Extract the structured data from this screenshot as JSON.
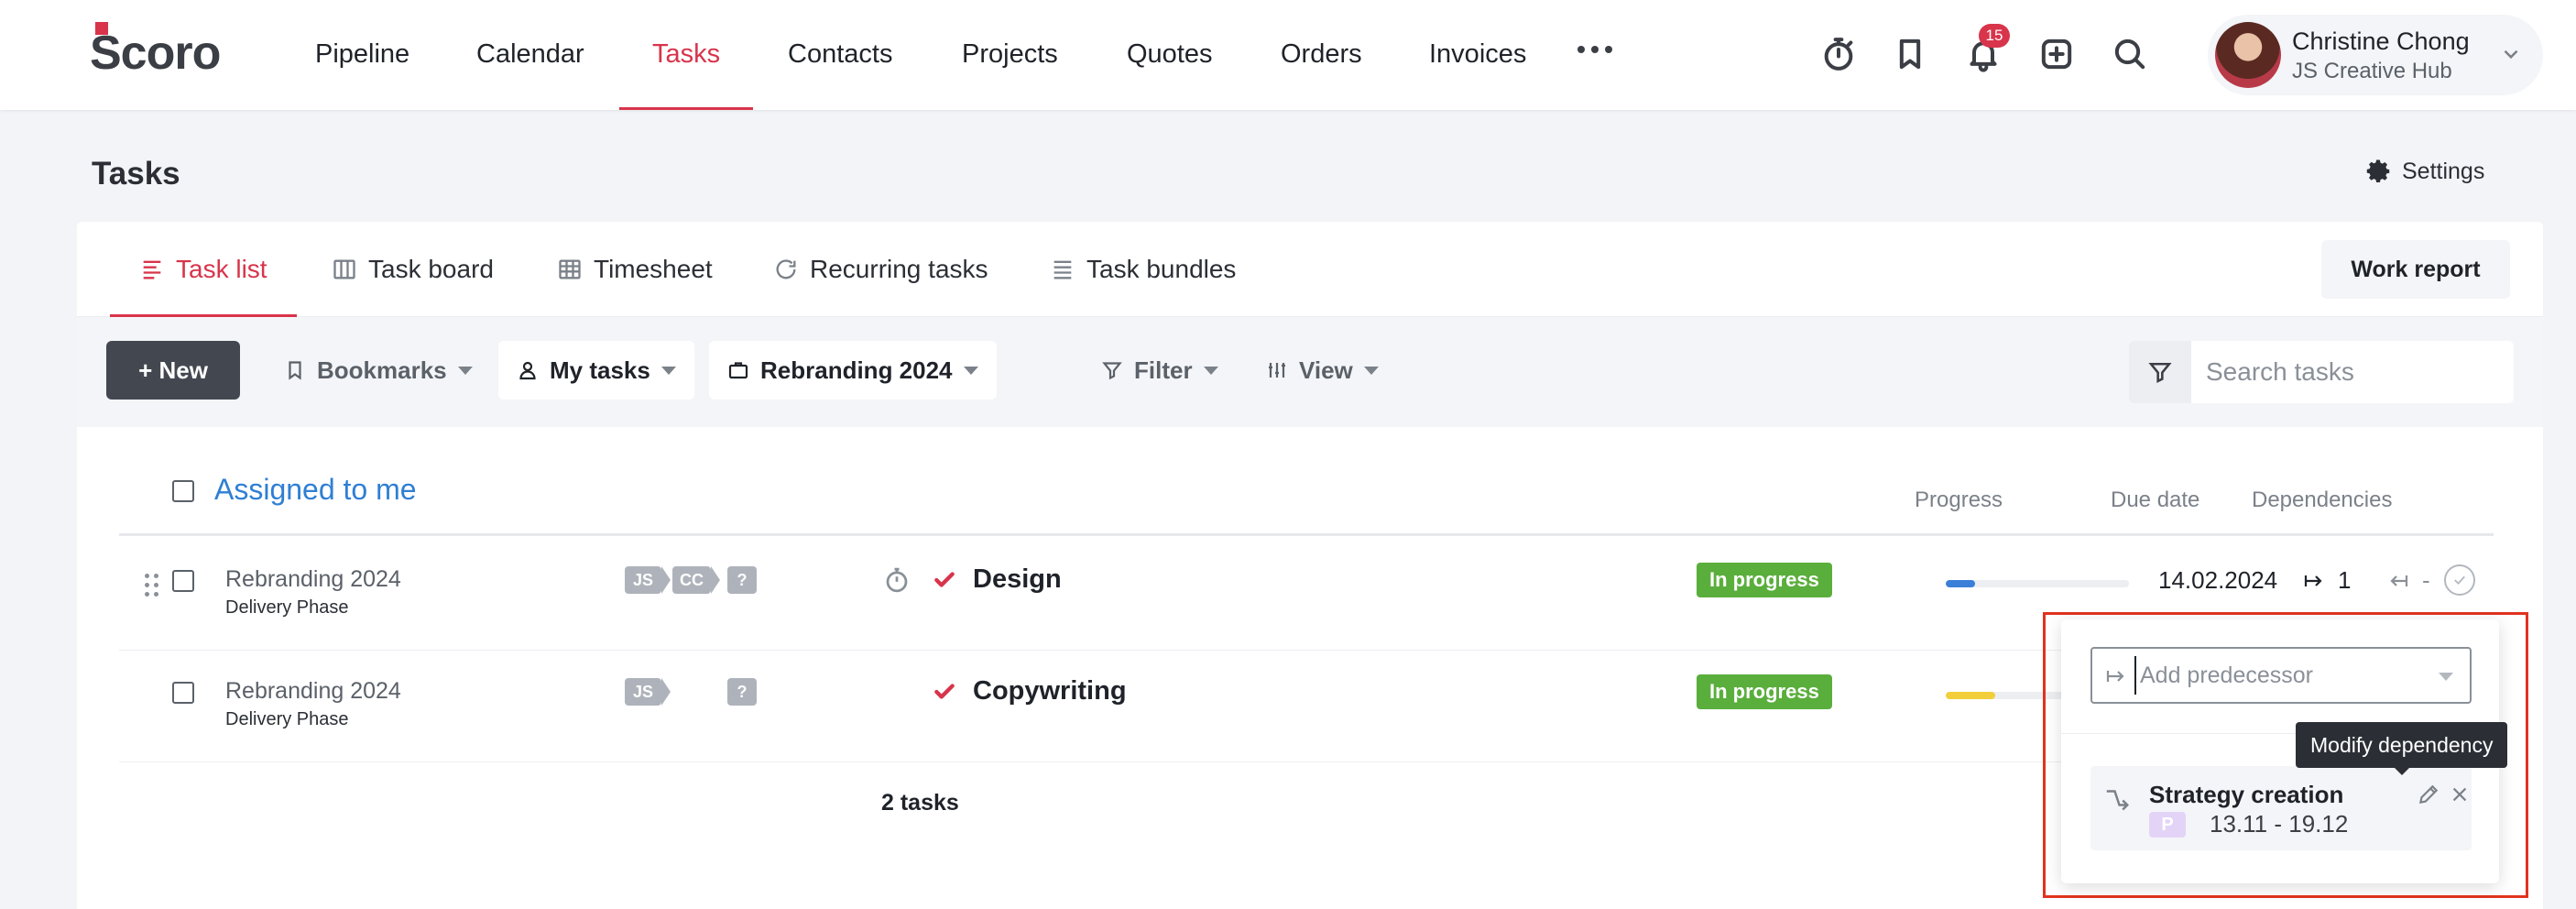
{
  "app": {
    "logo_text": "Scoro",
    "accent_color": "#d8344b"
  },
  "nav": {
    "items": [
      "Pipeline",
      "Calendar",
      "Tasks",
      "Contacts",
      "Projects",
      "Quotes",
      "Orders",
      "Invoices"
    ],
    "active": "Tasks",
    "more_icon": "more-horizontal-icon"
  },
  "toolbar_icons": [
    "timer-icon",
    "bookmark-icon",
    "bell-icon",
    "add-square-icon",
    "search-icon"
  ],
  "notifications": {
    "count": "15"
  },
  "user": {
    "name": "Christine Chong",
    "org": "JS Creative Hub"
  },
  "page": {
    "title": "Tasks",
    "settings_label": "Settings"
  },
  "tabs": {
    "items": [
      "Task list",
      "Task board",
      "Timesheet",
      "Recurring tasks",
      "Task bundles"
    ],
    "active": "Task list",
    "work_report": "Work report"
  },
  "filters": {
    "new_label": "+ New",
    "bookmarks": "Bookmarks",
    "my_tasks": "My tasks",
    "project": "Rebranding 2024",
    "filter": "Filter",
    "view": "View",
    "search_placeholder": "Search tasks"
  },
  "group": {
    "title": "Assigned to me",
    "columns": {
      "progress": "Progress",
      "due_date": "Due date",
      "dependencies": "Dependencies"
    }
  },
  "tasks": [
    {
      "project": "Rebranding 2024",
      "phase": "Delivery Phase",
      "tags": [
        "JS",
        "CC",
        "?"
      ],
      "name": "Design",
      "status": "In progress",
      "progress": 0.16,
      "progress_color": "#3a7fd8",
      "due_date": "14.02.2024",
      "successors": "1",
      "predecessors": "-"
    },
    {
      "project": "Rebranding 2024",
      "phase": "Delivery Phase",
      "tags": [
        "JS",
        "?"
      ],
      "name": "Copywriting",
      "status": "In progress",
      "progress": 0.27,
      "progress_color": "#f2cf3a"
    }
  ],
  "footer": {
    "tasks_count": "2 tasks"
  },
  "dependency_popup": {
    "input_placeholder": "Add predecessor",
    "item": {
      "title": "Strategy creation",
      "badge": "P",
      "dates": "13.11 - 19.12"
    },
    "tooltip": "Modify dependency"
  }
}
